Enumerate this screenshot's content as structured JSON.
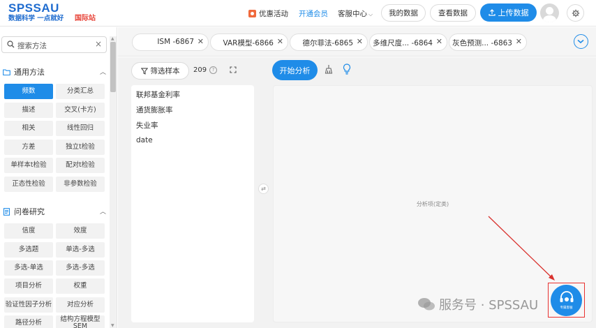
{
  "header": {
    "logo_main": "SPSSAU",
    "logo_sub": "数据科学 一点就好",
    "logo_intl": "国际站",
    "promo_label": "优惠活动",
    "vip_label": "开通会员",
    "service_label": "客服中心",
    "my_data_label": "我的数据",
    "view_data_label": "查看数据",
    "upload_label": "上传数据",
    "accent_color": "#1f8ce8"
  },
  "sidebar": {
    "search_placeholder": "搜索方法",
    "sections": [
      {
        "title": "通用方法",
        "items": [
          "频数",
          "分类汇总",
          "描述",
          "交叉(卡方)",
          "相关",
          "线性回归",
          "方差",
          "独立t检验",
          "单样本t检验",
          "配对t检验",
          "正态性检验",
          "非参数检验"
        ],
        "active": "频数"
      },
      {
        "title": "问卷研究",
        "items": [
          "信度",
          "效度",
          "多选题",
          "单选-多选",
          "多选-单选",
          "多选-多选",
          "项目分析",
          "权重",
          "验证性因子分析",
          "对应分析",
          "路径分析",
          "结构方程模型SEM"
        ]
      }
    ]
  },
  "tabs": [
    {
      "label": "ISM -6867"
    },
    {
      "label": "VAR模型-6866"
    },
    {
      "label": "德尔菲法-6865"
    },
    {
      "label": "多维尺度... -6864"
    },
    {
      "label": "灰色预测... -6863"
    }
  ],
  "main": {
    "filter_label": "筛选样本",
    "sample_count": "209",
    "help_char": "?",
    "variables": [
      "联邦基金利率",
      "通货膨胀率",
      "失业率",
      "date"
    ],
    "analyze_label": "开始分析",
    "drop_placeholder": "分析项(定类)"
  },
  "overlay": {
    "support_label": "专属客服",
    "watermark": "服务号 · SPSSAU"
  }
}
